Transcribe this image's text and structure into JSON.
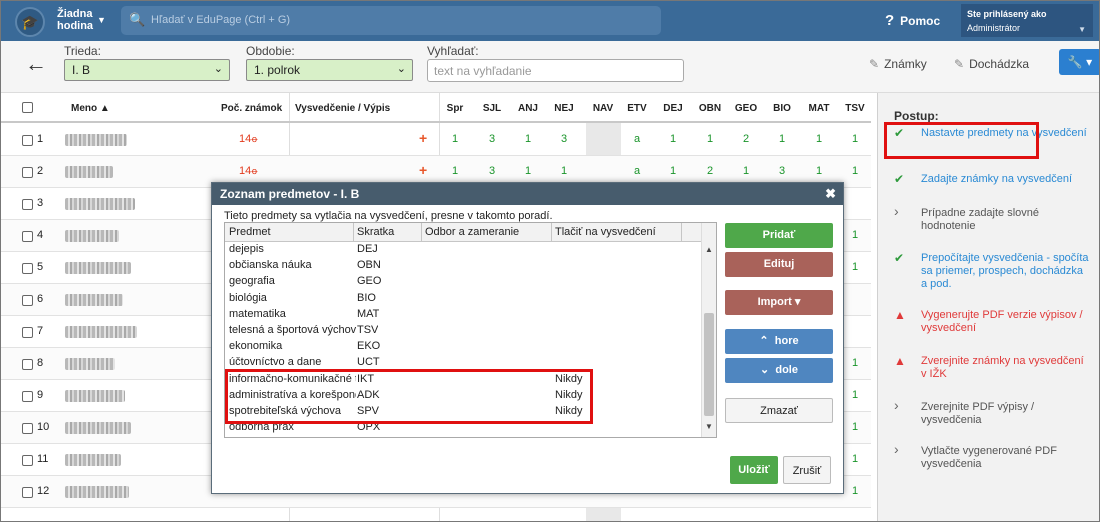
{
  "topbar": {
    "logo_icon": "mortarboard-icon",
    "hour_label": "Žiadna hodina",
    "search_placeholder": "Hľadať v EduPage (Ctrl + G)",
    "help_label": "Pomoc",
    "user_line1": "Ste prihlásený ako",
    "user_line2": "Administrátor"
  },
  "filter": {
    "class_label": "Trieda:",
    "class_value": "I. B",
    "period_label": "Obdobie:",
    "period_value": "1. polrok",
    "search_label": "Vyhľadať:",
    "search_placeholder": "text na vyhľadanie",
    "grades_label": "Známky",
    "attendance_label": "Dochádzka"
  },
  "grid": {
    "headers": {
      "name": "Meno ▲",
      "count": "Poč. známok",
      "cert": "Vysvedčenie / Výpis"
    },
    "subjects": [
      "Spr",
      "SJL",
      "ANJ",
      "NEJ",
      "NAV",
      "ETV",
      "DEJ",
      "OBN",
      "GEO",
      "BIO",
      "MAT",
      "TSV"
    ],
    "rows": [
      {
        "num": "1",
        "count": "14",
        "grades": [
          "1",
          "3",
          "1",
          "3",
          "",
          "a",
          "1",
          "1",
          "2",
          "1",
          "1",
          "1"
        ]
      },
      {
        "num": "2",
        "count": "14",
        "grades": [
          "1",
          "3",
          "1",
          "1",
          "",
          "a",
          "1",
          "2",
          "1",
          "3",
          "1",
          "1"
        ]
      },
      {
        "num": "3",
        "count": "",
        "grades": [
          "",
          "",
          "",
          "",
          "",
          "",
          "",
          "",
          "",
          "",
          "",
          ""
        ]
      },
      {
        "num": "4",
        "count": "",
        "grades": [
          "",
          "",
          "",
          "",
          "",
          "",
          "",
          "",
          "",
          "",
          "",
          "1"
        ]
      },
      {
        "num": "5",
        "count": "",
        "grades": [
          "",
          "",
          "",
          "",
          "",
          "",
          "",
          "",
          "",
          "",
          "",
          "1"
        ]
      },
      {
        "num": "6",
        "count": "",
        "grades": [
          "",
          "",
          "",
          "",
          "",
          "",
          "",
          "",
          "",
          "",
          "",
          ""
        ]
      },
      {
        "num": "7",
        "count": "",
        "grades": [
          "",
          "",
          "",
          "",
          "",
          "",
          "",
          "",
          "",
          "",
          "",
          ""
        ]
      },
      {
        "num": "8",
        "count": "",
        "grades": [
          "",
          "",
          "",
          "",
          "",
          "",
          "",
          "",
          "",
          "",
          "",
          "1"
        ]
      },
      {
        "num": "9",
        "count": "",
        "grades": [
          "",
          "",
          "",
          "",
          "",
          "",
          "",
          "",
          "",
          "",
          "",
          "1"
        ]
      },
      {
        "num": "10",
        "count": "",
        "grades": [
          "",
          "",
          "",
          "",
          "",
          "",
          "",
          "",
          "",
          "",
          "",
          "1"
        ]
      },
      {
        "num": "11",
        "count": "",
        "grades": [
          "",
          "",
          "",
          "",
          "",
          "",
          "",
          "",
          "",
          "",
          "",
          "1"
        ]
      },
      {
        "num": "12",
        "count": "",
        "grades": [
          "",
          "",
          "",
          "",
          "",
          "",
          "",
          "",
          "",
          "",
          "",
          "1"
        ]
      }
    ]
  },
  "steps": {
    "title": "Postup:",
    "items": [
      {
        "icon": "check-icon",
        "text": "Nastavte predmety na vysvedčení",
        "color": "#2a8ad4"
      },
      {
        "icon": "check-icon",
        "text": "Zadajte známky na vysvedčení",
        "color": "#2a8ad4"
      },
      {
        "icon": "chevron-right-icon",
        "text": "Prípadne zadajte slovné hodnotenie",
        "color": "#555555"
      },
      {
        "icon": "check-icon",
        "text": "Prepočítajte vysvedčenia - spočíta sa priemer, prospech, dochádzka a pod.",
        "color": "#2a8ad4"
      },
      {
        "icon": "warning-icon",
        "text": "Vygenerujte PDF verzie výpisov / vysvedčení",
        "color": "#e03a3a"
      },
      {
        "icon": "warning-icon",
        "text": "Zverejnite známky na vysvedčení v IŽK",
        "color": "#e03a3a"
      },
      {
        "icon": "chevron-right-icon",
        "text": "Zverejnite PDF výpisy / vysvedčenia",
        "color": "#555555"
      },
      {
        "icon": "chevron-right-icon",
        "text": "Vytlačte vygenerované PDF vysvedčenia",
        "color": "#555555"
      }
    ]
  },
  "dialog": {
    "title": "Zoznam predmetov - I. B",
    "note": "Tieto predmety sa vytlačia na vysvedčení, presne v takomto poradí.",
    "columns": [
      "Predmet",
      "Skratka",
      "Odbor a zameranie",
      "Tlačiť na vysvedčení"
    ],
    "items": [
      {
        "name": "dejepis",
        "abbr": "DEJ",
        "print": ""
      },
      {
        "name": "občianska náuka",
        "abbr": "OBN",
        "print": ""
      },
      {
        "name": "geografia",
        "abbr": "GEO",
        "print": ""
      },
      {
        "name": "biológia",
        "abbr": "BIO",
        "print": ""
      },
      {
        "name": "matematika",
        "abbr": "MAT",
        "print": ""
      },
      {
        "name": "telesná a športová výchova",
        "abbr": "TSV",
        "print": ""
      },
      {
        "name": "ekonomika",
        "abbr": "EKO",
        "print": ""
      },
      {
        "name": "účtovníctvo a dane",
        "abbr": "UCT",
        "print": ""
      },
      {
        "name": "informačno-komunikačné t",
        "abbr": "IKT",
        "print": "Nikdy"
      },
      {
        "name": "administratíva a korešpond",
        "abbr": "ADK",
        "print": "Nikdy"
      },
      {
        "name": "spotrebiteľská výchova",
        "abbr": "SPV",
        "print": "Nikdy"
      },
      {
        "name": "odborná prax",
        "abbr": "OPX",
        "print": ""
      }
    ],
    "buttons": {
      "add": "Pridať",
      "edit": "Edituj",
      "import": "Import ▾",
      "up": "hore",
      "down": "dole",
      "delete": "Zmazať",
      "save": "Uložiť",
      "cancel": "Zrušiť"
    },
    "colors": {
      "green": "#4fa84a",
      "brown": "#a9625a",
      "blue": "#4f86c0"
    }
  }
}
